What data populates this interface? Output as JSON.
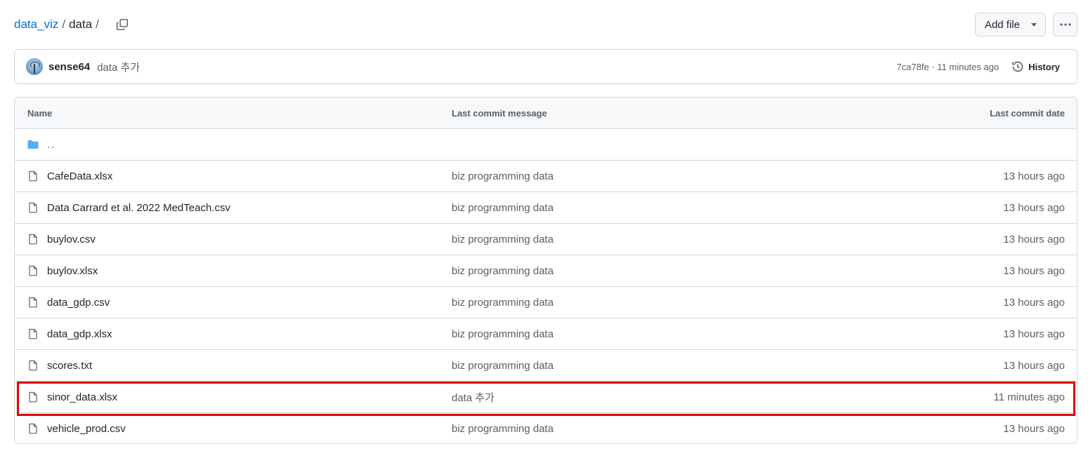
{
  "breadcrumb": {
    "repo": "data_viz",
    "separator": "/",
    "current": "data",
    "trailing": "/"
  },
  "toolbar": {
    "add_file_label": "Add file",
    "more_label": "···"
  },
  "latest_commit": {
    "author": "sense64",
    "message": "data 추가",
    "meta": "7ca78fe · 11 minutes ago",
    "history_label": "History"
  },
  "table": {
    "headers": {
      "name": "Name",
      "message": "Last commit message",
      "date": "Last commit date"
    },
    "parent_dir": "..",
    "rows": [
      {
        "name": "CafeData.xlsx",
        "message": "biz programming data",
        "date": "13 hours ago"
      },
      {
        "name": "Data Carrard et al. 2022 MedTeach.csv",
        "message": "biz programming data",
        "date": "13 hours ago"
      },
      {
        "name": "buylov.csv",
        "message": "biz programming data",
        "date": "13 hours ago"
      },
      {
        "name": "buylov.xlsx",
        "message": "biz programming data",
        "date": "13 hours ago"
      },
      {
        "name": "data_gdp.csv",
        "message": "biz programming data",
        "date": "13 hours ago"
      },
      {
        "name": "data_gdp.xlsx",
        "message": "biz programming data",
        "date": "13 hours ago"
      },
      {
        "name": "scores.txt",
        "message": "biz programming data",
        "date": "13 hours ago"
      },
      {
        "name": "sinor_data.xlsx",
        "message": "data 추가",
        "date": "11 minutes ago"
      },
      {
        "name": "vehicle_prod.csv",
        "message": "biz programming data",
        "date": "13 hours ago"
      }
    ]
  },
  "icons": {
    "copy": "copy-icon",
    "folder": "folder-icon",
    "file": "file-icon",
    "history": "history-icon",
    "kebab": "kebab-horizontal-icon",
    "caret": "triangle-down-icon"
  },
  "colors": {
    "link": "#0969da",
    "muted": "#57606a",
    "border": "#d0d7de",
    "header_bg": "#f6f8fa",
    "folder": "#54aeff",
    "highlight": "#e00000"
  }
}
